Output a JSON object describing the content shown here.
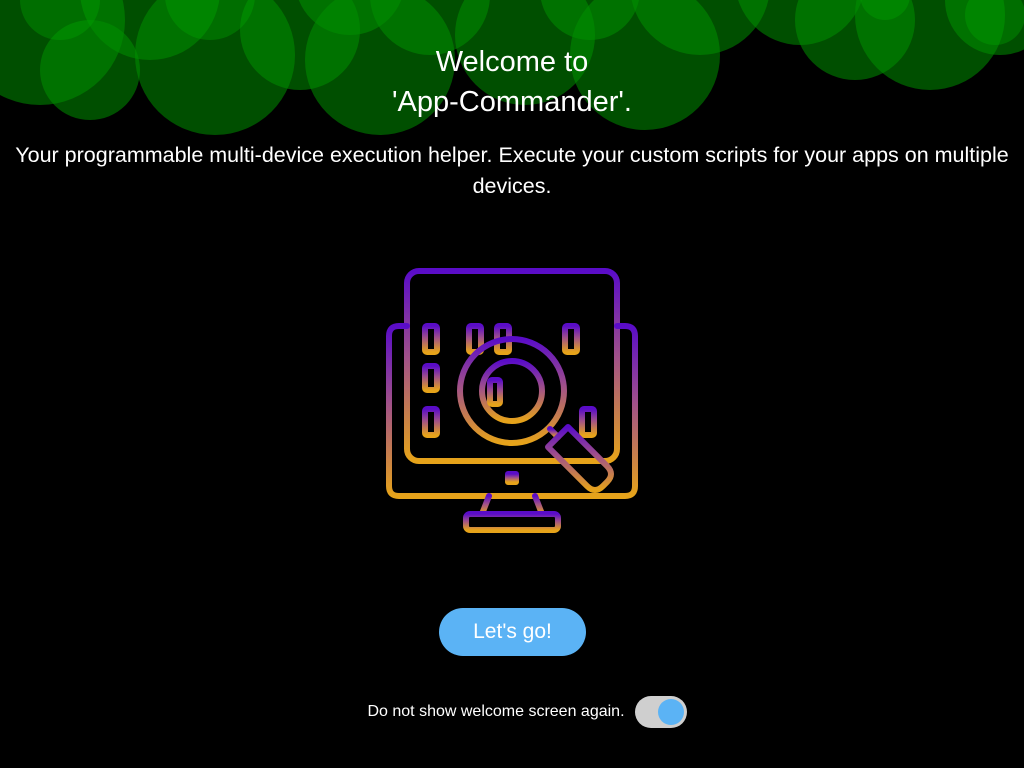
{
  "welcome": {
    "title_line1": "Welcome to",
    "title_line2": "'App-Commander'.",
    "subtitle": "Your programmable multi-device execution helper. Execute your custom scripts for your apps on multiple devices."
  },
  "hero": {
    "icon": "monitor-binary-magnifier-icon",
    "gradient_top": "#5a0cc8",
    "gradient_bottom": "#e6a31a"
  },
  "actions": {
    "go_label": "Let's go!"
  },
  "settings": {
    "hide_welcome_label": "Do not show welcome screen again.",
    "hide_welcome_enabled": true
  },
  "colors": {
    "background": "#000000",
    "accent": "#5bb3f5",
    "bokeh": "#008a00"
  }
}
